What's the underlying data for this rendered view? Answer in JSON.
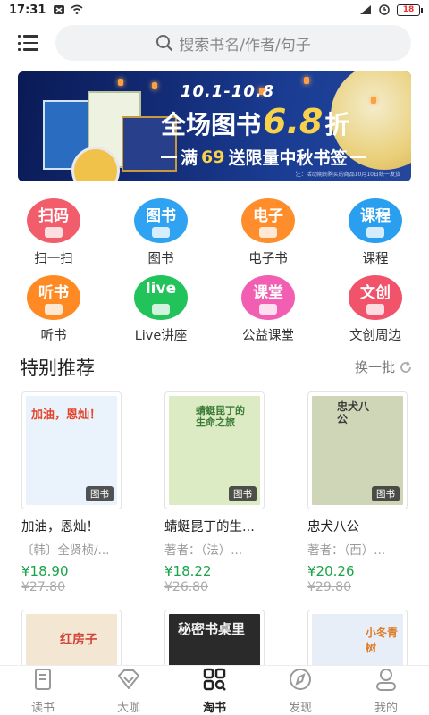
{
  "status_bar": {
    "time": "17:31",
    "battery": "18"
  },
  "header": {
    "search_placeholder": "搜索书名/作者/句子"
  },
  "banner": {
    "date_range": "10.1-10.8",
    "headline_prefix": "全场图书",
    "headline_value": "6.8",
    "headline_suffix": "折",
    "sub_prefix": "满",
    "sub_number": "69",
    "sub_suffix": "送限量中秋书签",
    "note": "注：活动期间购买的商品10月10日统一发货"
  },
  "categories": [
    {
      "icon_text": "扫码",
      "label": "扫一扫",
      "color": "#f25d6b"
    },
    {
      "icon_text": "图书",
      "label": "图书",
      "color": "#2fa3f1"
    },
    {
      "icon_text": "电子",
      "label": "电子书",
      "color": "#ff8d2b"
    },
    {
      "icon_text": "课程",
      "label": "课程",
      "color": "#2a9ff0"
    },
    {
      "icon_text": "听书",
      "label": "听书",
      "color": "#ff8a24"
    },
    {
      "icon_text": "live",
      "label": "Live讲座",
      "color": "#22c35a"
    },
    {
      "icon_text": "课堂",
      "label": "公益课堂",
      "color": "#f25fb2"
    },
    {
      "icon_text": "文创",
      "label": "文创周边",
      "color": "#f0536a"
    }
  ],
  "section": {
    "title": "特别推荐",
    "refresh_label": "换一批"
  },
  "books": [
    {
      "cover_title": "加油，恩灿！",
      "tag": "图书",
      "title": "加油，恩灿！",
      "author": "〔韩〕全贤桢/...",
      "price": "¥18.90",
      "original_price": "¥27.80",
      "cover_bg": "#eaf3fb"
    },
    {
      "cover_title": "蜻蜓昆丁的生命之旅",
      "tag": "图书",
      "title": "蜻蜓昆丁的生...",
      "author": "著者：（法）...",
      "price": "¥18.22",
      "original_price": "¥26.80",
      "cover_bg": "#dcebc4"
    },
    {
      "cover_title": "忠犬八公",
      "tag": "图书",
      "title": "忠犬八公",
      "author": "著者：（西）...",
      "price": "¥20.26",
      "original_price": "¥29.80",
      "cover_bg": "#cfd6b8"
    }
  ],
  "books_row2": [
    {
      "cover_title": "红房子",
      "cover_bg": "#f3e7d4"
    },
    {
      "cover_title": "秘密书桌里",
      "cover_bg": "#2b2a2a"
    },
    {
      "cover_title": "小冬青树",
      "cover_bg": "#e7eef8"
    }
  ],
  "nav": [
    {
      "label": "读书",
      "icon": "book-icon",
      "active": false
    },
    {
      "label": "大咖",
      "icon": "diamond-icon",
      "active": false
    },
    {
      "label": "淘书",
      "icon": "grid-search-icon",
      "active": true
    },
    {
      "label": "发现",
      "icon": "compass-icon",
      "active": false
    },
    {
      "label": "我的",
      "icon": "person-icon",
      "active": false
    }
  ]
}
